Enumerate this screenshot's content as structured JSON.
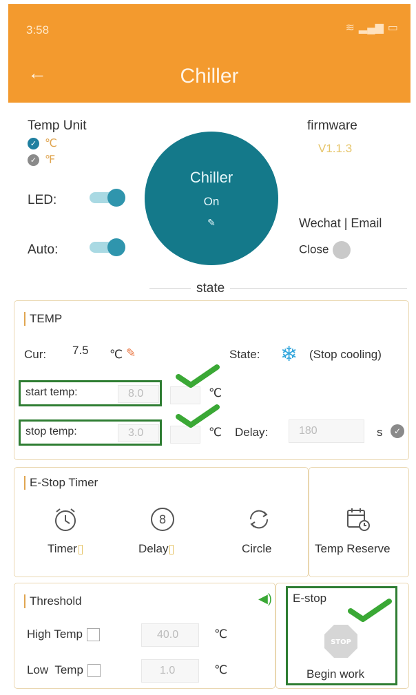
{
  "status_bar": {
    "time": "3:58"
  },
  "header": {
    "title": "Chiller"
  },
  "top": {
    "temp_unit_label": "Temp Unit",
    "unit_c": "℃",
    "unit_f": "℉",
    "led_label": "LED:",
    "auto_label": "Auto:",
    "circle_title": "Chiller",
    "circle_state": "On",
    "firmware_label": "firmware",
    "firmware_version": "V1.1.3",
    "wechat_email": "Wechat | Email",
    "close_label": "Close",
    "state_label": "state"
  },
  "temp": {
    "title": "TEMP",
    "cur_label": "Cur:",
    "cur_value": "7.5",
    "cur_unit": "℃",
    "state_label": "State:",
    "state_value": "(Stop cooling)",
    "start_label": "start temp:",
    "start_value": "8.0",
    "stop_label": "stop temp:",
    "stop_value": "3.0",
    "unit": "℃",
    "delay_label": "Delay:",
    "delay_value": "180",
    "delay_unit": "s"
  },
  "timer": {
    "title": "E-Stop Timer",
    "items": [
      "Timer",
      "Delay",
      "Circle"
    ],
    "reserve_label": "Temp Reserve"
  },
  "threshold": {
    "title": "Threshold",
    "high_label": "High Temp",
    "high_value": "40.0",
    "low_label": "Low  Temp",
    "low_value": "1.0",
    "unit": "℃"
  },
  "estop": {
    "title": "E-stop",
    "stop_text": "STOP",
    "begin_label": "Begin work"
  },
  "colors": {
    "header": "#f39a2e",
    "teal": "#14798a",
    "check_green": "#2e7d32"
  }
}
